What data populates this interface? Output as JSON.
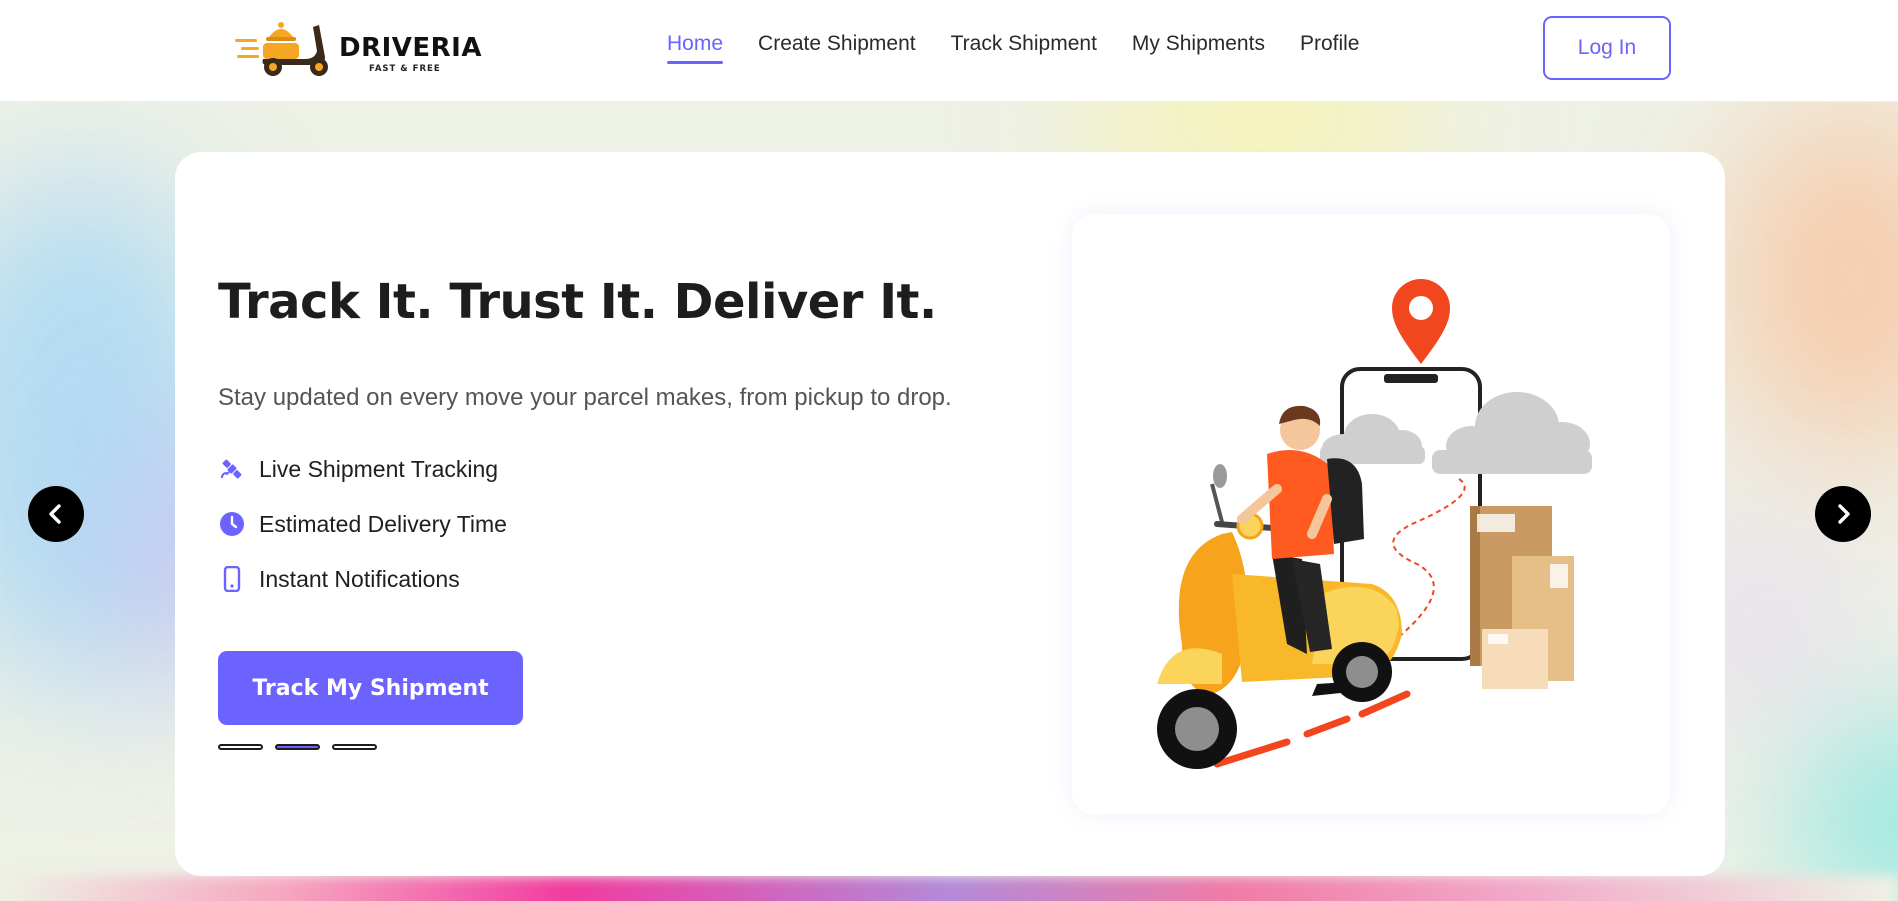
{
  "brand": {
    "name": "DRIVERIA",
    "tagline": "FAST & FREE",
    "colors": {
      "accent": "#6c63ff",
      "logo_orange": "#f5a623",
      "pin_red": "#f2461e"
    }
  },
  "nav": {
    "items": [
      {
        "label": "Home",
        "active": true
      },
      {
        "label": "Create Shipment",
        "active": false
      },
      {
        "label": "Track Shipment",
        "active": false
      },
      {
        "label": "My Shipments",
        "active": false
      },
      {
        "label": "Profile",
        "active": false
      }
    ],
    "login_label": "Log In"
  },
  "hero": {
    "title": "Track It. Trust It. Deliver It.",
    "subtitle": "Stay updated on every move your parcel makes, from pickup to drop.",
    "features": [
      {
        "icon": "satellite-icon",
        "label": "Live Shipment Tracking"
      },
      {
        "icon": "clock-icon",
        "label": "Estimated Delivery Time"
      },
      {
        "icon": "phone-icon",
        "label": "Instant Notifications"
      }
    ],
    "cta_label": "Track My Shipment",
    "slides": {
      "count": 3,
      "active_index": 1
    },
    "illustration": "delivery-scooter-illustration"
  },
  "carousel": {
    "prev_icon": "chevron-left-icon",
    "next_icon": "chevron-right-icon"
  }
}
